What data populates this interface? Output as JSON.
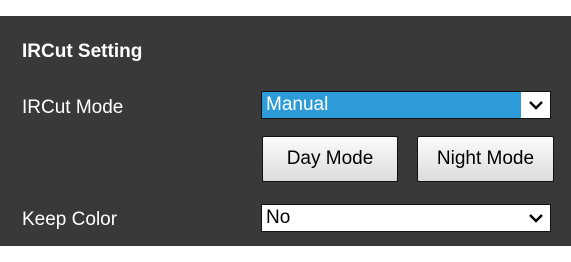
{
  "section": {
    "title": "IRCut Setting"
  },
  "ircut_mode": {
    "label": "IRCut Mode",
    "selected": "Manual"
  },
  "buttons": {
    "day_mode": "Day Mode",
    "night_mode": "Night Mode"
  },
  "keep_color": {
    "label": "Keep Color",
    "selected": "No"
  },
  "icons": {
    "dropdown": "chevron-down-icon"
  },
  "colors": {
    "panel_background": "#393939",
    "selection_highlight": "#2c9bd8",
    "text": "#ffffff"
  }
}
